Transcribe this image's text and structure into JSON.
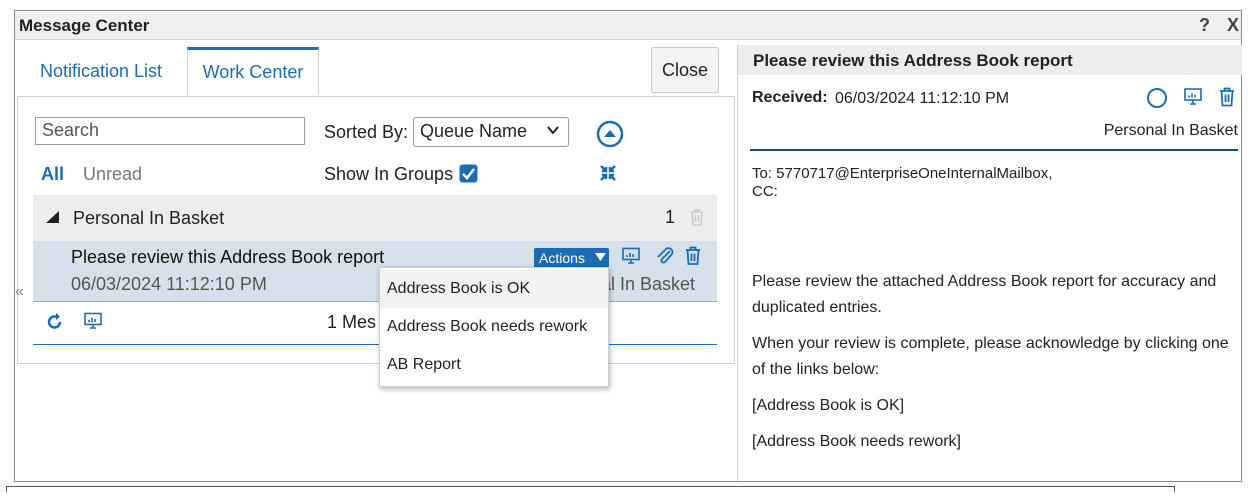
{
  "window": {
    "title": "Message Center",
    "help": "?",
    "close": "X"
  },
  "tabs": [
    {
      "label": "Notification List",
      "active": false
    },
    {
      "label": "Work Center",
      "active": true
    }
  ],
  "toolbar": {
    "close_label": "Close",
    "search_placeholder": "Search",
    "sorted_by_label": "Sorted By:",
    "sort_value": "Queue Name",
    "filter_all": "All",
    "filter_unread": "Unread",
    "show_in_groups_label": "Show In Groups",
    "show_in_groups_checked": true
  },
  "group": {
    "name": "Personal In Basket",
    "count": "1"
  },
  "message": {
    "subject": "Please review this Address Book report",
    "date": "06/03/2024 11:12:10 PM",
    "basket_partial": "al In Basket",
    "actions_label": "Actions"
  },
  "footer": {
    "count_partial": "1 Mes"
  },
  "actions_menu": {
    "items": [
      "Address Book is OK",
      "Address Book needs rework",
      "AB Report"
    ]
  },
  "detail": {
    "subject": "Please review this Address Book report",
    "received_label": "Received:",
    "received_value": "06/03/2024 11:12:10 PM",
    "basket": "Personal In Basket",
    "to_line": "To: 5770717@EnterpriseOneInternalMailbox,",
    "cc_line": "CC:",
    "body": [
      "Please review the attached Address Book report for accuracy and duplicated entries.",
      "When your review is complete, please acknowledge by clicking one of the links below:",
      "[Address Book is OK]",
      "[Address Book needs rework]"
    ]
  },
  "colors": {
    "accent": "#1b6cb3",
    "row_selected": "#d6e0ea",
    "header_gray": "#ededed"
  },
  "icons": [
    "help-icon",
    "close-icon",
    "scroll-top-icon",
    "collapse-icon",
    "triangle-down-icon",
    "trash-icon",
    "monitor-icon",
    "paperclip-icon",
    "refresh-icon",
    "circle-icon",
    "chevron-down-icon",
    "checkbox-icon"
  ]
}
